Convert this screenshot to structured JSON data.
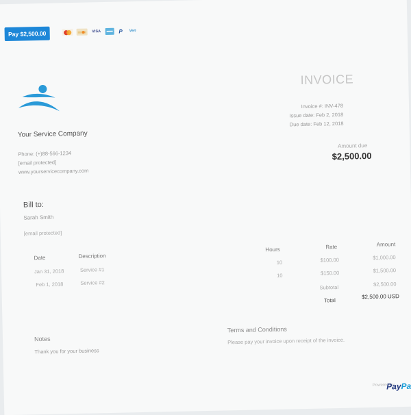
{
  "pay_button": {
    "label": "Pay $2,500.00"
  },
  "payment_methods": [
    {
      "name": "mastercard-icon",
      "text": "",
      "bg": "#f6f0e6",
      "fg": "#e0402a",
      "w": 16
    },
    {
      "name": "discover-icon",
      "text": "",
      "bg": "#efe2c3",
      "fg": "#b07b2c",
      "w": 16
    },
    {
      "name": "visa-icon",
      "text": "VISA",
      "bg": "transparent",
      "fg": "#3d4b8e",
      "w": 16
    },
    {
      "name": "amex-icon",
      "text": "",
      "bg": "#5fb4df",
      "fg": "#ffffff",
      "w": 13
    },
    {
      "name": "paypal-p-icon",
      "text": "P",
      "bg": "transparent",
      "fg": "#1a4e9c",
      "w": 9
    },
    {
      "name": "venmo-icon",
      "text": "Ven",
      "bg": "transparent",
      "fg": "#3d95ce",
      "w": 16
    }
  ],
  "company": {
    "name": "Your Service Company",
    "phone": "Phone: (+)88-566-1234",
    "email": "[email protected]",
    "website": "www.yourservicecompany.com"
  },
  "invoice": {
    "title": "INVOICE",
    "number_line": "Invoice #: INV-478",
    "issue_line": "Issue date: Feb 2, 2018",
    "due_line": "Due date: Feb 12, 2018",
    "amount_due_label": "Amount due",
    "amount_due": "$2,500.00"
  },
  "bill_to": {
    "heading": "Bill to:",
    "name": "Sarah Smith",
    "email": "[email protected]"
  },
  "table": {
    "headers": {
      "date": "Date",
      "description": "Description",
      "hours": "Hours",
      "rate": "Rate",
      "amount": "Amount"
    },
    "rows": [
      {
        "date": "Jan 31, 2018",
        "description": "Service #1",
        "hours": "10",
        "rate": "$100.00",
        "amount": "$1,000.00"
      },
      {
        "date": "Feb 1, 2018",
        "description": "Service #2",
        "hours": "10",
        "rate": "$150.00",
        "amount": "$1,500.00"
      }
    ],
    "subtotal_label": "Subtotal",
    "subtotal_value": "$2,500.00",
    "total_label": "Total",
    "total_value": "$2,500.00 USD"
  },
  "notes": {
    "heading": "Notes",
    "text": "Thank you for your business"
  },
  "terms": {
    "heading": "Terms and Conditions",
    "text": "Please pay your invoice upon receipt of the invoice."
  },
  "footer": {
    "powered_by": "Powered by",
    "brand": "PayPal",
    "brand_color_1": "#253b80",
    "brand_color_2": "#179bd7"
  }
}
